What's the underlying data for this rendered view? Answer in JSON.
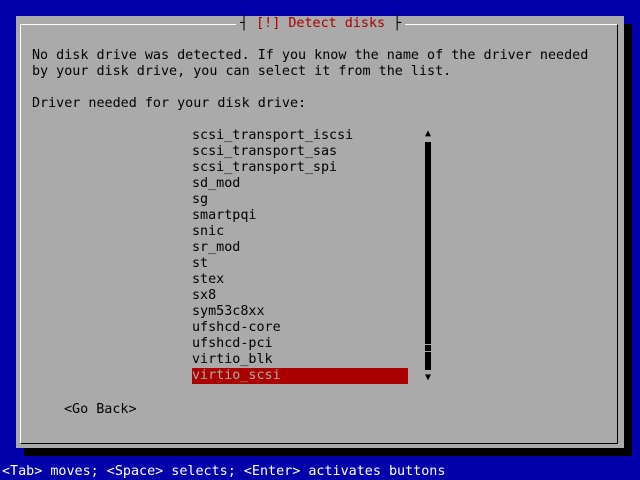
{
  "dialog": {
    "title_mark": "[!]",
    "title_text": "Detect disks",
    "message_line1": "No disk drive was detected. If you know the name of the driver needed",
    "message_line2": "by your disk drive, you can select it from the list.",
    "prompt": "Driver needed for your disk drive:",
    "go_back": "<Go Back>"
  },
  "driver_list": {
    "items": [
      "scsi_transport_iscsi",
      "scsi_transport_sas",
      "scsi_transport_spi",
      "sd_mod",
      "sg",
      "smartpqi",
      "snic",
      "sr_mod",
      "st",
      "stex",
      "sx8",
      "sym53c8xx",
      "ufshcd-core",
      "ufshcd-pci",
      "virtio_blk",
      "virtio_scsi"
    ],
    "selected": "virtio_scsi",
    "scroll_position": 0.92
  },
  "statusbar": {
    "text": "<Tab> moves; <Space> selects; <Enter> activates buttons"
  },
  "colors": {
    "background": "#0000aa",
    "dialog": "#aaaaaa",
    "title": "#aa0000",
    "selection": "#aa0000",
    "status_text": "#ffffff"
  },
  "icons": {
    "scroll_up": "scroll-up-arrow-icon",
    "scroll_down": "scroll-down-arrow-icon"
  }
}
